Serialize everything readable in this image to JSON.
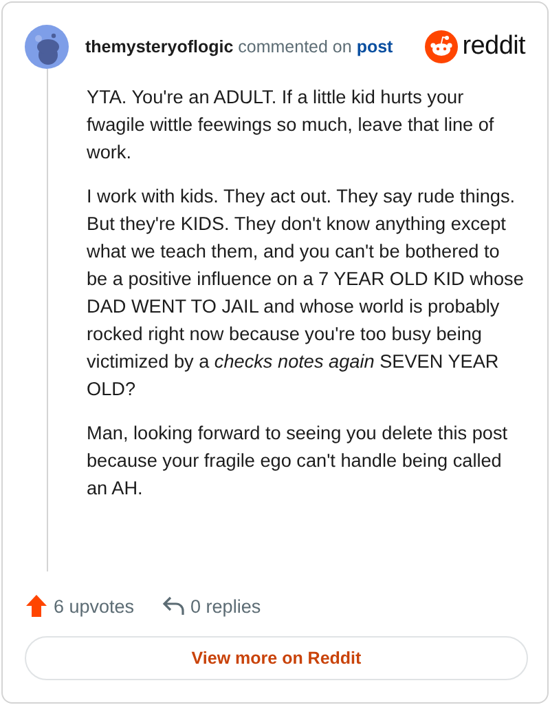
{
  "header": {
    "username": "themysteryoflogic",
    "action": "commented on",
    "link": "post",
    "brand": "reddit"
  },
  "comment": {
    "paragraphs": [
      "YTA. You're an ADULT. If a little kid hurts your fwagile wittle feewings so much, leave that line of work.",
      "I work with kids. They act out. They say rude things. But they're KIDS. They don't know anything except what we teach them, and you can't be bothered to be a positive influence on a 7 YEAR OLD KID whose DAD WENT TO JAIL and whose world is probably rocked right now because you're too busy being victimized by a *checks notes again* SEVEN YEAR OLD?",
      "Man, looking forward to seeing you delete this post because your fragile ego can't handle being called an AH."
    ]
  },
  "actions": {
    "upvotes": "6 upvotes",
    "replies": "0 replies"
  },
  "button": "View more on Reddit"
}
